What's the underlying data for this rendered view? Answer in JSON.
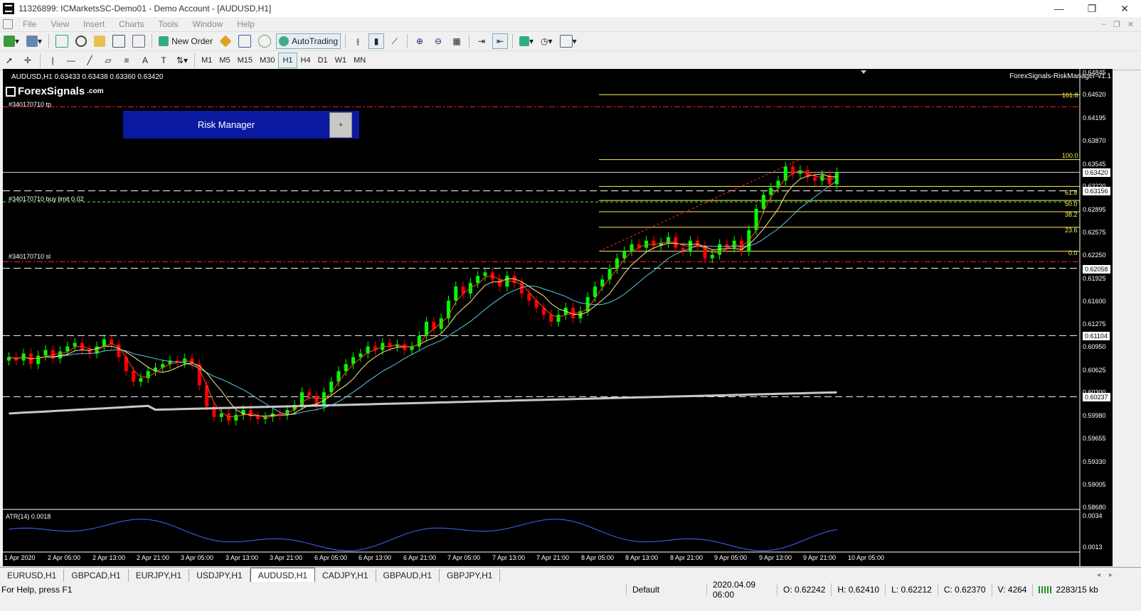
{
  "window": {
    "title": "11326899: ICMarketsSC-Demo01 - Demo Account - [AUDUSD,H1]",
    "min": "—",
    "restore": "❐",
    "close": "✕"
  },
  "menu": [
    "File",
    "View",
    "Insert",
    "Charts",
    "Tools",
    "Window",
    "Help"
  ],
  "toolbar": {
    "new_order": "New Order",
    "autotrading": "AutoTrading"
  },
  "timeframes": [
    "M1",
    "M5",
    "M15",
    "M30",
    "H1",
    "H4",
    "D1",
    "W1",
    "MN"
  ],
  "chart": {
    "symbol_header": "AUDUSD,H1  0.63433 0.63438 0.63360 0.63420",
    "indicator_name": "ForexSignals-RiskManager-v1.1",
    "logo_text": "ForexSignals",
    "logo_suffix": ".com",
    "risk_button": "Risk Manager",
    "risk_plus": "+",
    "order_tp": "#340170710 tp",
    "order_buy": "#340170710 buy limit 0.02",
    "order_sl": "#340170710 sl",
    "atr_label": "ATR(14) 0.0018"
  },
  "fib_levels": [
    "161.8",
    "100.0",
    "61.8",
    "50.0",
    "38.2",
    "23.6",
    "0.0"
  ],
  "price_axis": [
    "0.64845",
    "0.64520",
    "0.64195",
    "0.63870",
    "0.63545",
    "0.63420",
    "0.63220",
    "0.63156",
    "0.62895",
    "0.62575",
    "0.62250",
    "0.62058",
    "0.61925",
    "0.61600",
    "0.61275",
    "0.61104",
    "0.60950",
    "0.60625",
    "0.60300",
    "0.60237",
    "0.59980",
    "0.59655",
    "0.59330",
    "0.59005",
    "0.58680"
  ],
  "atr_axis": [
    "0.0034",
    "0.0013"
  ],
  "time_axis": [
    "1 Apr 2020",
    "2 Apr 05:00",
    "2 Apr 13:00",
    "2 Apr 21:00",
    "3 Apr 05:00",
    "3 Apr 13:00",
    "3 Apr 21:00",
    "6 Apr 05:00",
    "6 Apr 13:00",
    "6 Apr 21:00",
    "7 Apr 05:00",
    "7 Apr 13:00",
    "7 Apr 21:00",
    "8 Apr 05:00",
    "8 Apr 13:00",
    "8 Apr 21:00",
    "9 Apr 05:00",
    "9 Apr 13:00",
    "9 Apr 21:00",
    "10 Apr 05:00"
  ],
  "tabs": [
    "EURUSD,H1",
    "GBPCAD,H1",
    "EURJPY,H1",
    "USDJPY,H1",
    "AUDUSD,H1",
    "CADJPY,H1",
    "GBPAUD,H1",
    "GBPJPY,H1"
  ],
  "active_tab": "AUDUSD,H1",
  "status": {
    "help": "For Help, press F1",
    "profile": "Default",
    "time": "2020.04.09 06:00",
    "open": "O: 0.62242",
    "high": "H: 0.62410",
    "low": "L: 0.62212",
    "close": "C: 0.62370",
    "volume": "V: 4264",
    "traffic": "2283/15 kb"
  },
  "colors": {
    "bull": "#00ff00",
    "bear": "#ff0000",
    "fib": "#ffee55",
    "ma_slow": "#c8c8c8",
    "ma_fast": "#ff4a2a",
    "ma_mid": "#ffee88",
    "ma_cyan": "#5ac8e6",
    "atr": "#4466ff",
    "risk_button_bg": "#0a1aa0"
  }
}
